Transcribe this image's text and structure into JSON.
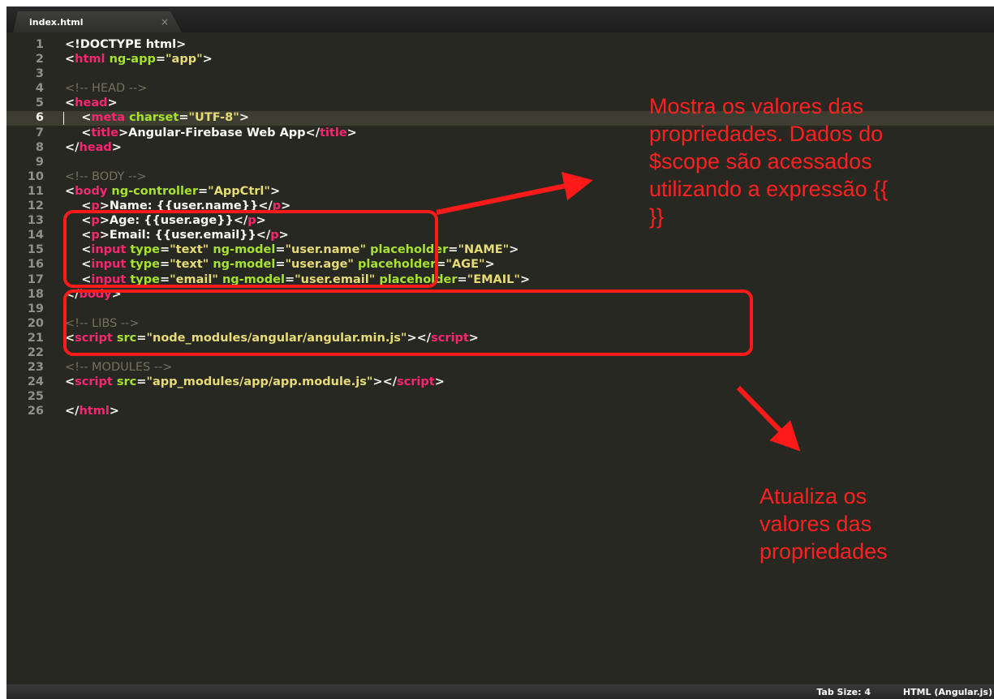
{
  "tab": {
    "title": "index.html",
    "close_glyph": "×"
  },
  "editor": {
    "line_numbers": [
      "1",
      "2",
      "3",
      "4",
      "5",
      "6",
      "7",
      "8",
      "9",
      "10",
      "11",
      "12",
      "13",
      "14",
      "15",
      "16",
      "17",
      "18",
      "19",
      "20",
      "21",
      "22",
      "23",
      "24",
      "25",
      "26"
    ],
    "current_line": "6"
  },
  "code": {
    "l1": [
      "<!DOCTYPE html>"
    ],
    "l2": [
      "<",
      "html",
      " ",
      "ng-app",
      "=",
      "\"app\"",
      ">"
    ],
    "l4": [
      "<!-- HEAD -->"
    ],
    "l5": [
      "<",
      "head",
      ">"
    ],
    "l6": [
      "    <",
      "meta",
      " ",
      "charset",
      "=",
      "\"UTF-8\"",
      ">"
    ],
    "l7": [
      "    <",
      "title",
      ">Angular-Firebase Web App</",
      "title",
      ">"
    ],
    "l8": [
      "</",
      "head",
      ">"
    ],
    "l10": [
      "<!-- BODY -->"
    ],
    "l11": [
      "<",
      "body",
      " ",
      "ng-controller",
      "=",
      "\"AppCtrl\"",
      ">"
    ],
    "l12": [
      "    <",
      "p",
      ">Name: {{user.name}}</",
      "p",
      ">"
    ],
    "l13": [
      "    <",
      "p",
      ">Age: {{user.age}}</",
      "p",
      ">"
    ],
    "l14": [
      "    <",
      "p",
      ">Email: {{user.email}}</",
      "p",
      ">"
    ],
    "l15": [
      "    <",
      "input",
      " ",
      "type",
      "=",
      "\"text\"",
      " ",
      "ng-model",
      "=",
      "\"user.name\"",
      " ",
      "placeholder",
      "=",
      "\"NAME\"",
      ">"
    ],
    "l16": [
      "    <",
      "input",
      " ",
      "type",
      "=",
      "\"text\"",
      " ",
      "ng-model",
      "=",
      "\"user.age\"",
      " ",
      "placeholder",
      "=",
      "\"AGE\"",
      ">"
    ],
    "l17": [
      "    <",
      "input",
      " ",
      "type",
      "=",
      "\"email\"",
      " ",
      "ng-model",
      "=",
      "\"user.email\"",
      " ",
      "placeholder",
      "=",
      "\"EMAIL\"",
      ">"
    ],
    "l18": [
      "</",
      "body",
      ">"
    ],
    "l20": [
      "<!-- LIBS -->"
    ],
    "l21": [
      "<",
      "script",
      " ",
      "src",
      "=",
      "\"node_modules/angular/angular.min.js\"",
      "></",
      "script",
      ">"
    ],
    "l23": [
      "<!-- MODULES -->"
    ],
    "l24": [
      "<",
      "script",
      " ",
      "src",
      "=",
      "\"app_modules/app/app.module.js\"",
      "></",
      "script",
      ">"
    ],
    "l26": [
      "</",
      "html",
      ">"
    ]
  },
  "annotations": {
    "note_top": [
      "Mostra os valores das",
      "propriedades. Dados do",
      "$scope são acessados",
      "utilizando a expressão {{",
      "}}"
    ],
    "note_bottom": [
      "Atualiza os",
      "valores das",
      "propriedades"
    ],
    "color": "#ff1a1a"
  },
  "status_bar": {
    "tab_size": "Tab Size: 4",
    "syntax": "HTML (Angular.js)"
  },
  "colors": {
    "background": "#272822",
    "tag": "#f92672",
    "attribute": "#a6e22e",
    "string": "#e6db74",
    "comment": "#75715e",
    "text": "#f8f8f2"
  }
}
